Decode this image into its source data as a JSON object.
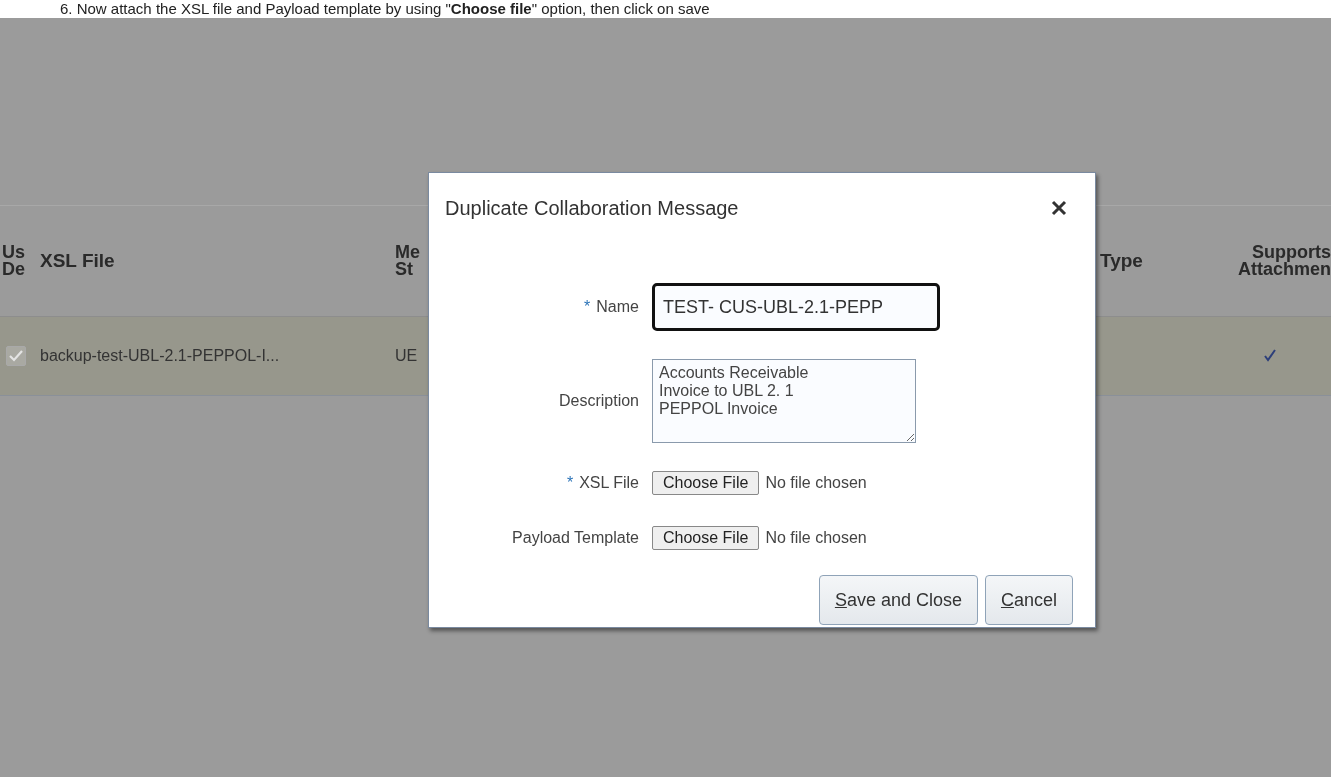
{
  "instruction": "6.  Now attach the XSL file and Payload template by using \"**Choose file**\" option, then click on save",
  "table": {
    "columns": [
      {
        "lines": [
          "Us",
          "De"
        ]
      },
      {
        "lines": [
          "XSL File"
        ]
      },
      {
        "lines": [
          "Me",
          "St"
        ]
      },
      {
        "lines": [
          "Type"
        ]
      },
      {
        "lines": [
          "Supports",
          "Attachmen"
        ]
      }
    ],
    "rows": [
      {
        "selected": true,
        "checked": true,
        "xsl_file": "backup-test-UBL-2.1-PEPPOL-I...",
        "column_3": "UE",
        "supports_attachments": true
      }
    ]
  },
  "dialog": {
    "title": "Duplicate Collaboration Message",
    "fields": [
      {
        "kind": "text",
        "label": "Name",
        "required_mark": "*",
        "value": "TEST- CUS-UBL-2.1-PEPP",
        "focused": true
      },
      {
        "kind": "textarea",
        "label": "Description",
        "value": "Accounts Receivable Invoice to UBL 2. 1 PEPPOL Invoice"
      },
      {
        "kind": "file",
        "label": "XSL File",
        "required_mark": "*",
        "button": "Choose File",
        "status": "No file chosen"
      },
      {
        "kind": "file",
        "label": "Payload Template",
        "button": "Choose File",
        "status": "No file chosen"
      }
    ],
    "buttons": [
      {
        "label": "Save and Close"
      },
      {
        "label": "Cancel"
      }
    ]
  }
}
